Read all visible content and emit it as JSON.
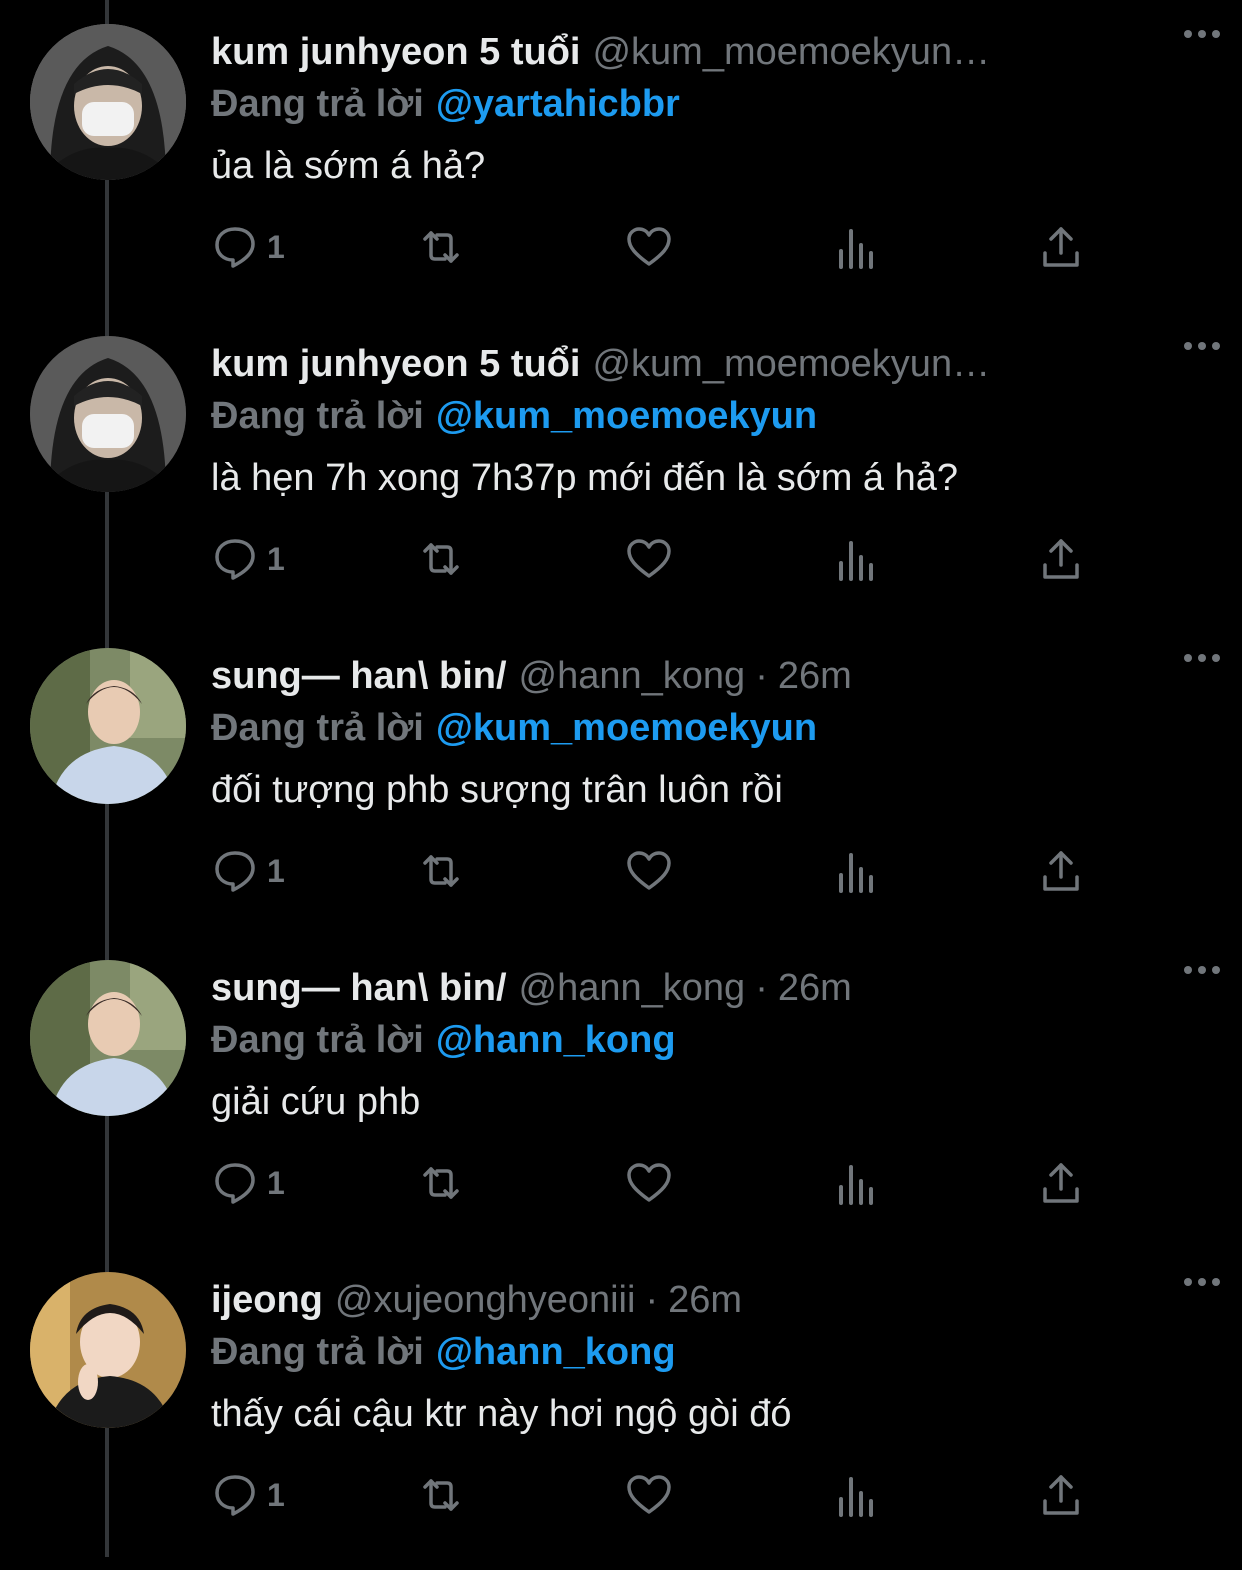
{
  "tweets": [
    {
      "display_name": "kum junhyeon 5 tuổi",
      "handle": "@kum_moemoekyun…",
      "time": "",
      "reply_label": "Đang trả lời",
      "reply_to": "@yartahicbbr",
      "text": "ủa là sớm á hả?",
      "reply_count": "1"
    },
    {
      "display_name": "kum junhyeon 5 tuổi",
      "handle": "@kum_moemoekyun…",
      "time": "",
      "reply_label": "Đang trả lời",
      "reply_to": "@kum_moemoekyun",
      "text": "là hẹn 7h xong 7h37p mới đến là sớm á hả?",
      "reply_count": "1"
    },
    {
      "display_name": "sung— han\\ bin/",
      "handle": "@hann_kong",
      "time": "26m",
      "reply_label": "Đang trả lời",
      "reply_to": "@kum_moemoekyun",
      "text": "đối tượng phb sượng trân luôn rồi",
      "reply_count": "1"
    },
    {
      "display_name": "sung— han\\ bin/",
      "handle": "@hann_kong",
      "time": "26m",
      "reply_label": "Đang trả lời",
      "reply_to": "@hann_kong",
      "text": "giải cứu phb",
      "reply_count": "1"
    },
    {
      "display_name": "ijeong",
      "handle": "@xujeonghyeoniii",
      "time": "26m",
      "reply_label": "Đang trả lời",
      "reply_to": "@hann_kong",
      "text": "thấy cái cậu ktr này hơi ngộ gòi đó",
      "reply_count": "1"
    }
  ],
  "separator": "·",
  "icons": {
    "reply": "reply-icon",
    "retweet": "retweet-icon",
    "like": "heart-icon",
    "views": "views-icon",
    "share": "share-icon",
    "more": "more-icon"
  },
  "colors": {
    "background": "#000000",
    "text": "#e7e9ea",
    "muted": "#71767b",
    "link": "#1d9bf0",
    "thread_line": "#333639"
  }
}
